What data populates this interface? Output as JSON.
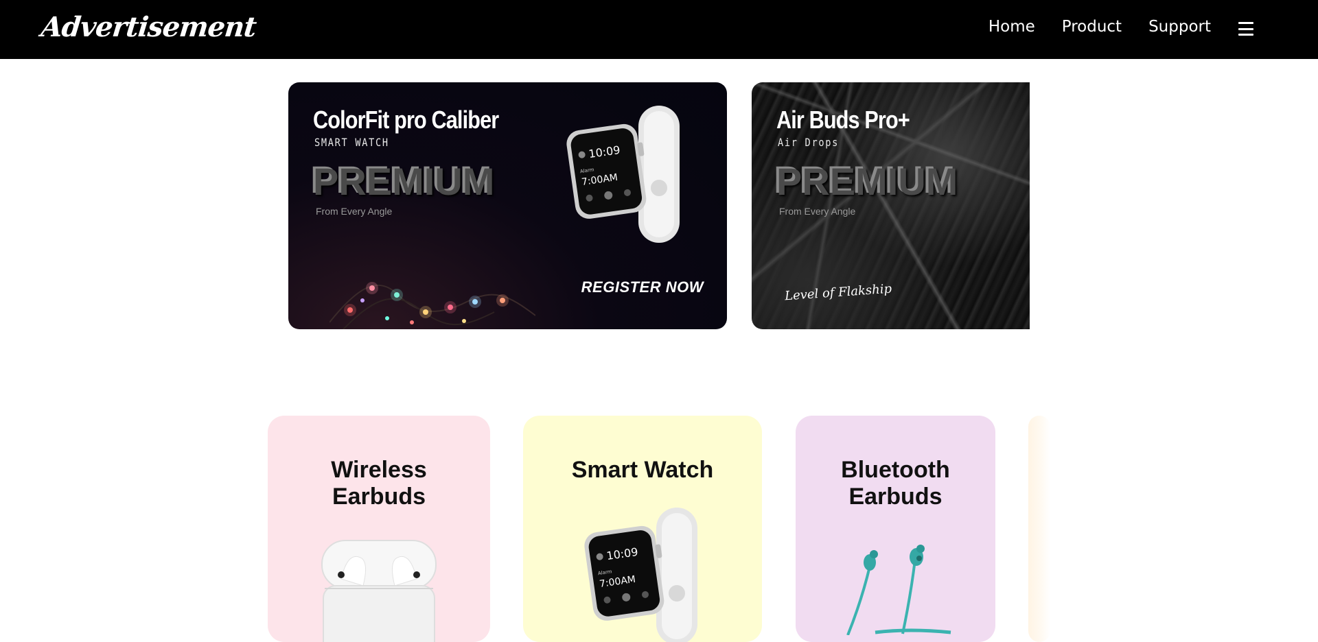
{
  "navbar": {
    "brand": "Advertisement",
    "links": [
      "Home",
      "Product",
      "Support"
    ],
    "menu_icon": "hamburger-icon"
  },
  "banners": [
    {
      "title": "ColorFit pro Caliber",
      "subtitle": "SMART WATCH",
      "headline": "PREMIUM",
      "tagline": "From Every Angle",
      "cta": "REGISTER NOW",
      "image": "smartwatch-image"
    },
    {
      "title": "Air Buds Pro+",
      "subtitle": "Air Drops",
      "headline": "PREMIUM",
      "tagline": "From Every Angle",
      "script_text": "Level of Flakship"
    }
  ],
  "products": [
    {
      "title": "Wireless Earbuds",
      "color": "#fde4ea",
      "image": "airpods-case-image"
    },
    {
      "title": "Smart Watch",
      "color": "#fefdd2",
      "image": "smartwatch-image"
    },
    {
      "title": "Bluetooth Earbuds",
      "color": "#f1dcf1",
      "image": "neckband-earbuds-image"
    },
    {
      "title": "",
      "color": "#fff4e4",
      "image": ""
    }
  ],
  "watch_face": {
    "time": "10:09",
    "alarm_label": "Alarm",
    "alarm_time": "7:00AM"
  }
}
